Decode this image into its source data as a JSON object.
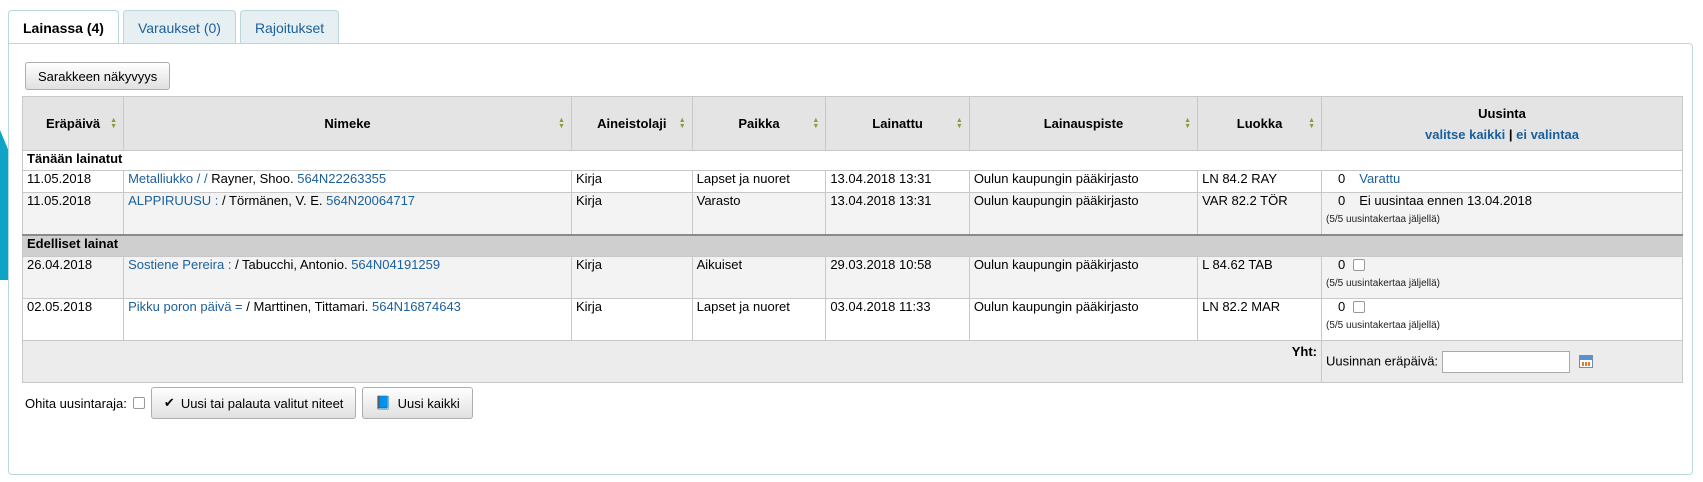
{
  "tabs": [
    {
      "label": "Lainassa (4)",
      "active": true
    },
    {
      "label": "Varaukset (0)",
      "active": false
    },
    {
      "label": "Rajoitukset",
      "active": false
    }
  ],
  "column_visibility_label": "Sarakkeen näkyvyys",
  "columns": {
    "due": "Eräpäivä",
    "title": "Nimeke",
    "itemtype": "Aineistolaji",
    "location": "Paikka",
    "checkedout": "Lainattu",
    "branch": "Lainauspiste",
    "callnumber": "Luokka",
    "renew": "Uusinta",
    "select_all": "valitse kaikki",
    "separator": "|",
    "select_none": "ei valintaa"
  },
  "groups": {
    "today": "Tänään lainatut",
    "previous": "Edelliset lainat"
  },
  "rows": [
    {
      "due": "11.05.2018",
      "title": "Metalliukko / /",
      "author": "Rayner, Shoo.",
      "barcode": "564N22263355",
      "itemtype": "Kirja",
      "location": "Lapset ja nuoret",
      "checkedout": "13.04.2018 13:31",
      "branch": "Oulun kaupungin pääkirjasto",
      "callnumber": "LN 84.2 RAY",
      "renew_count": "0",
      "renew_status": "Varattu",
      "note": ""
    },
    {
      "due": "11.05.2018",
      "title": "ALPPIRUUSU :",
      "author": "/ Törmänen, V. E.",
      "barcode": "564N20064717",
      "itemtype": "Kirja",
      "location": "Varasto",
      "checkedout": "13.04.2018 13:31",
      "branch": "Oulun kaupungin pääkirjasto",
      "callnumber": "VAR 82.2 TÖR",
      "renew_count": "0",
      "renew_status": "Ei uusintaa ennen 13.04.2018",
      "note": "(5/5 uusintakertaa jäljellä)"
    },
    {
      "due": "26.04.2018",
      "title": "Sostiene Pereira :",
      "author": "/ Tabucchi, Antonio.",
      "barcode": "564N04191259",
      "itemtype": "Kirja",
      "location": "Aikuiset",
      "checkedout": "29.03.2018 10:58",
      "branch": "Oulun kaupungin pääkirjasto",
      "callnumber": "L 84.62 TAB",
      "renew_count": "0",
      "renew_status": "",
      "note": "(5/5 uusintakertaa jäljellä)"
    },
    {
      "due": "02.05.2018",
      "title": "Pikku poron päivä =",
      "author": "/ Marttinen, Tittamari.",
      "barcode": "564N16874643",
      "itemtype": "Kirja",
      "location": "Lapset ja nuoret",
      "checkedout": "03.04.2018 11:33",
      "branch": "Oulun kaupungin pääkirjasto",
      "callnumber": "LN 82.2 MAR",
      "renew_count": "0",
      "renew_status": "",
      "note": "(5/5 uusintakertaa jäljellä)"
    }
  ],
  "footer": {
    "total_label": "Yht:",
    "renew_due_label": "Uusinnan eräpäivä:",
    "renew_due_value": ""
  },
  "bottom": {
    "override_label": "Ohita uusintaraja:",
    "renew_selected": "Uusi tai palauta valitut niteet",
    "renew_all": "Uusi kaikki"
  },
  "colors": {
    "link": "#1b5f9c",
    "accent": "#0fa3c5"
  }
}
